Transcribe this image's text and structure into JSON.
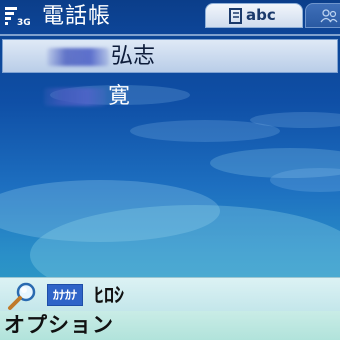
{
  "status": {
    "network": "3G"
  },
  "app": {
    "title": "電話帳"
  },
  "tabs": [
    {
      "label": "abc",
      "icon": "contact-book-icon",
      "active": true
    },
    {
      "label": "",
      "icon": "contacts-group-icon",
      "active": false
    }
  ],
  "contacts": [
    {
      "name": "弘志",
      "selected": true
    },
    {
      "name": "寛",
      "selected": false
    }
  ],
  "search": {
    "mode_label": "ｶﾅｶﾅ",
    "query": "ﾋﾛｼ"
  },
  "softkeys": {
    "left": "オプション"
  },
  "colors": {
    "background_top": "#0a3f8c",
    "background_bottom": "#2fa7c0",
    "selection": "#cfdcee",
    "search_bar": "#c3e6ea"
  }
}
